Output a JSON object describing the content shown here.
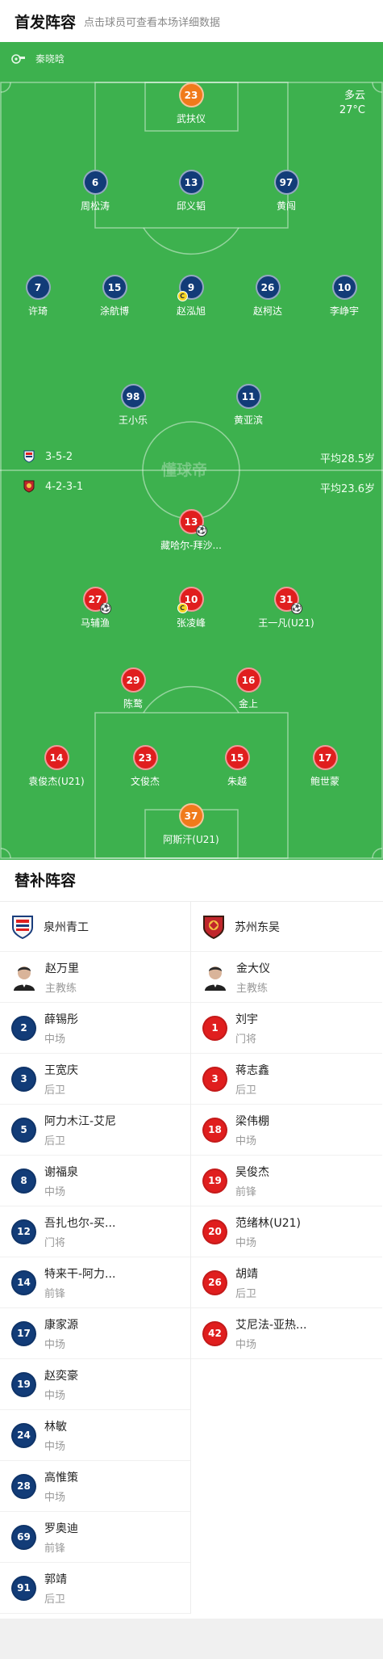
{
  "header": {
    "title": "首发阵容",
    "subtitle": "点击球员可查看本场详细数据"
  },
  "referee": {
    "name": "秦晓晗",
    "icon": "whistle-icon"
  },
  "weather": {
    "condition": "多云",
    "temperature": "27°C"
  },
  "watermark": "懂球帝",
  "colors": {
    "pitch": "#3db14e",
    "home": "#123c78",
    "away": "#e01e1e",
    "goalkeeper": "#f07a1b"
  },
  "home": {
    "formation": "3-5-2",
    "average_age": "平均28.5岁",
    "players": [
      {
        "number": "23",
        "name": "武扶仪",
        "gk": true
      },
      {
        "number": "6",
        "name": "周松涛"
      },
      {
        "number": "13",
        "name": "邱义韬"
      },
      {
        "number": "97",
        "name": "黄闯"
      },
      {
        "number": "7",
        "name": "许琦"
      },
      {
        "number": "15",
        "name": "涂航博"
      },
      {
        "number": "9",
        "name": "赵泓旭",
        "captain": true
      },
      {
        "number": "26",
        "name": "赵柯达"
      },
      {
        "number": "10",
        "name": "李峥宇"
      },
      {
        "number": "98",
        "name": "王小乐"
      },
      {
        "number": "11",
        "name": "黄亚滨"
      }
    ]
  },
  "away": {
    "formation": "4-2-3-1",
    "average_age": "平均23.6岁",
    "players": [
      {
        "number": "13",
        "name": "藏哈尔-拜沙...",
        "goal": true
      },
      {
        "number": "27",
        "name": "马辅渔",
        "goal": true
      },
      {
        "number": "10",
        "name": "张凌峰",
        "captain": true
      },
      {
        "number": "31",
        "name": "王一凡(U21)",
        "goal": true
      },
      {
        "number": "29",
        "name": "陈鹜"
      },
      {
        "number": "16",
        "name": "金上"
      },
      {
        "number": "14",
        "name": "袁俊杰(U21)"
      },
      {
        "number": "23",
        "name": "文俊杰"
      },
      {
        "number": "15",
        "name": "朱越"
      },
      {
        "number": "17",
        "name": "鲍世蒙"
      },
      {
        "number": "37",
        "name": "阿斯汗(U21)",
        "gk": true
      }
    ]
  },
  "captain_badge": "C",
  "subs": {
    "title": "替补阵容",
    "left": {
      "team": "泉州青工",
      "coach": {
        "name": "赵万里",
        "role": "主教练"
      },
      "players": [
        {
          "number": "2",
          "name": "薛锡彤",
          "pos": "中场"
        },
        {
          "number": "3",
          "name": "王宽庆",
          "pos": "后卫"
        },
        {
          "number": "5",
          "name": "阿力木江-艾尼",
          "pos": "后卫"
        },
        {
          "number": "8",
          "name": "谢福泉",
          "pos": "中场"
        },
        {
          "number": "12",
          "name": "吾扎也尔-买...",
          "pos": "门将"
        },
        {
          "number": "14",
          "name": "特来干-阿力...",
          "pos": "前锋"
        },
        {
          "number": "17",
          "name": "康家源",
          "pos": "中场"
        },
        {
          "number": "19",
          "name": "赵奕豪",
          "pos": "中场"
        },
        {
          "number": "24",
          "name": "林敏",
          "pos": "中场"
        },
        {
          "number": "28",
          "name": "高惟策",
          "pos": "中场"
        },
        {
          "number": "69",
          "name": "罗奥迪",
          "pos": "前锋"
        },
        {
          "number": "91",
          "name": "郭靖",
          "pos": "后卫"
        }
      ]
    },
    "right": {
      "team": "苏州东吴",
      "coach": {
        "name": "金大仪",
        "role": "主教练"
      },
      "players": [
        {
          "number": "1",
          "name": "刘宇",
          "pos": "门将"
        },
        {
          "number": "3",
          "name": "蒋志鑫",
          "pos": "后卫"
        },
        {
          "number": "18",
          "name": "梁伟棚",
          "pos": "中场"
        },
        {
          "number": "19",
          "name": "吴俊杰",
          "pos": "前锋"
        },
        {
          "number": "20",
          "name": "范绪林(U21)",
          "pos": "中场"
        },
        {
          "number": "26",
          "name": "胡靖",
          "pos": "后卫"
        },
        {
          "number": "42",
          "name": "艾尼法-亚热...",
          "pos": "中场"
        }
      ]
    }
  }
}
